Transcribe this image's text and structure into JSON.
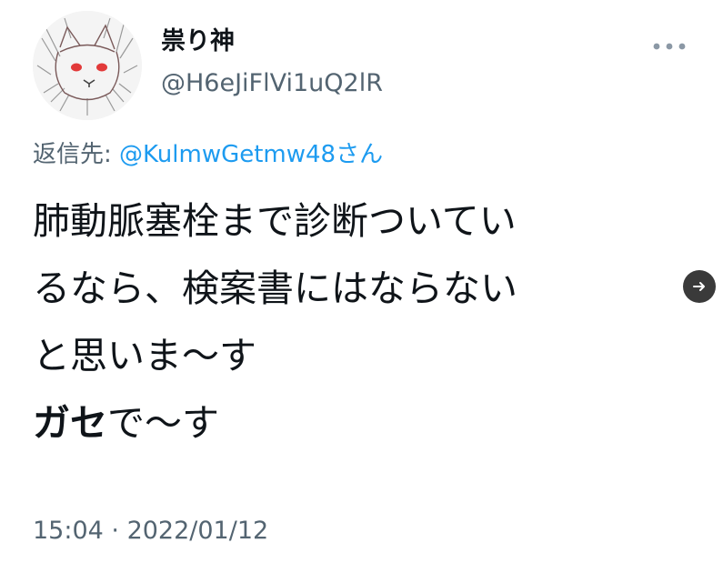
{
  "author": {
    "display_name": "祟り神",
    "handle": "@H6eJiFlVi1uQ2lR",
    "avatar_icon": "cat-sketch-avatar-icon"
  },
  "reply": {
    "prefix": "返信先: ",
    "mention": "@KulmwGetmw48",
    "suffix": "さん"
  },
  "tweet": {
    "lines": [
      "肺動脈塞栓まで診断ついてい",
      "るなら、検案書にはならない",
      "と思いま〜す"
    ],
    "last_line_bold": "ガセ",
    "last_line_rest": "で〜す"
  },
  "meta": {
    "time": "15:04",
    "separator": " · ",
    "date": "2022/01/12"
  },
  "icons": {
    "more": "more-dots-icon",
    "next": "arrow-right-icon"
  },
  "colors": {
    "text": "#0f1419",
    "secondary": "#536471",
    "link": "#1d9bf0",
    "arrow_bg": "#3a3a3a"
  }
}
